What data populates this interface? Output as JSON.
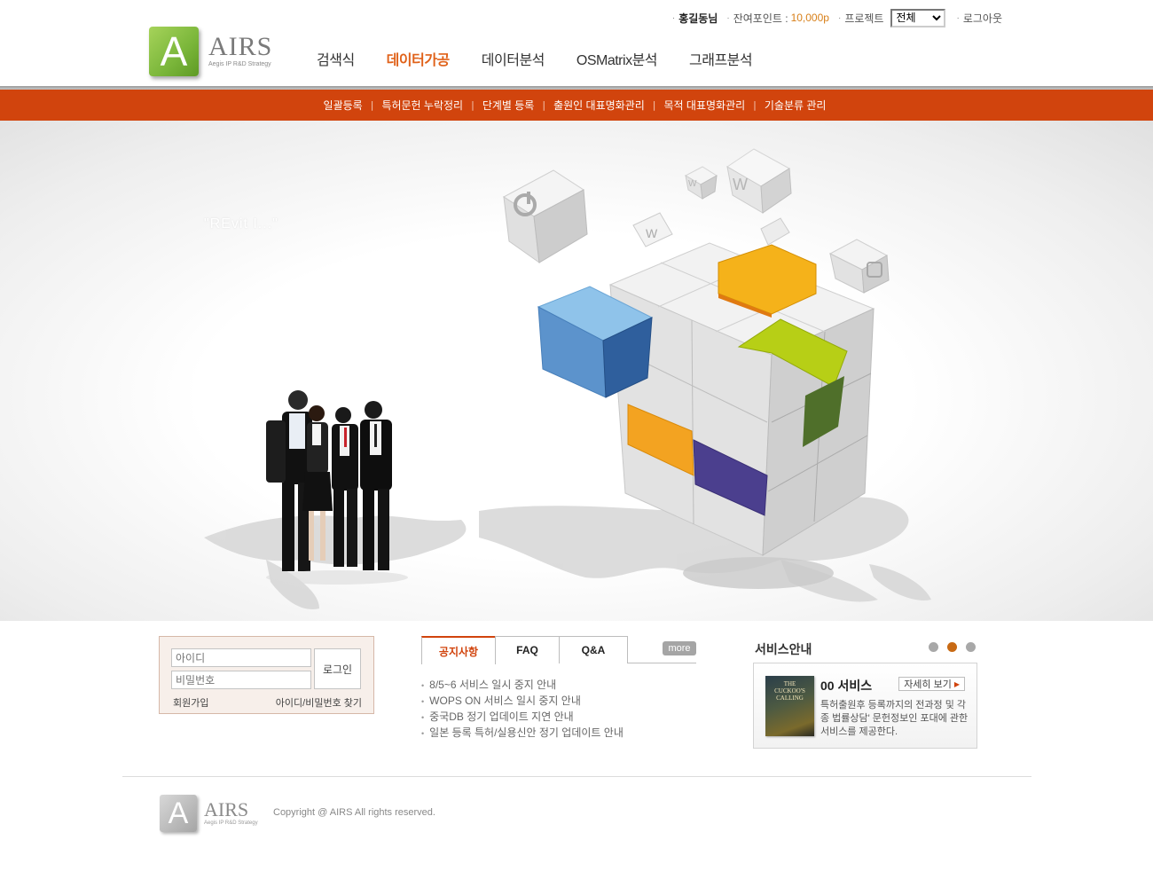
{
  "brand": {
    "name": "AIRS",
    "letter": "A",
    "tagline": "Aegis IP R&D Strategy",
    "accent_color": "#d1440d",
    "logo_green": "#7ab63a"
  },
  "util": {
    "user": "홍길동님",
    "points_label": "잔여포인트 :",
    "points_value": "10,000p",
    "project_label": "프로젝트",
    "project_selected": "전체",
    "logout": "로그아웃"
  },
  "gnb": [
    {
      "label": "검색식",
      "active": false
    },
    {
      "label": "데이터가공",
      "active": true
    },
    {
      "label": "데이터분석",
      "active": false
    },
    {
      "label": "OSMatrix분석",
      "active": false
    },
    {
      "label": "그래프분석",
      "active": false
    }
  ],
  "subnav": [
    "일괄등록",
    "특허문헌 누락정리",
    "단계별 등록",
    "출원인 대표명화관리",
    "목적 대표명화관리",
    "기술분류 관리"
  ],
  "hero": {
    "slogan": "\"REvit I...\""
  },
  "login": {
    "id_placeholder": "아이디",
    "pw_placeholder": "비밀번호",
    "login_button": "로그인",
    "join": "회원가입",
    "find": "아이디/비밀번호 찾기"
  },
  "notice": {
    "tabs": [
      "공지사항",
      "FAQ",
      "Q&A"
    ],
    "more": "more",
    "items": [
      "8/5~6 서비스 일시 중지 안내",
      "WOPS ON 서비스 일시 중지 안내",
      "중국DB 정기 업데이트 지연 안내",
      "일본 등록 특허/실용신안 정기 업데이트 안내"
    ]
  },
  "service": {
    "title": "서비스안내",
    "name": "00 서비스",
    "detail_button": "자세히 보기",
    "book_title": "THE CUCKOO'S CALLING",
    "description": "특허출원후 등록까지의 전과정 및 각종 법률상담' 문헌정보인 포대에 관한 서비스를 제공한다.",
    "pager": [
      false,
      true,
      false
    ]
  },
  "footer": {
    "copyright": "Copyright @ AIRS All rights reserved."
  }
}
